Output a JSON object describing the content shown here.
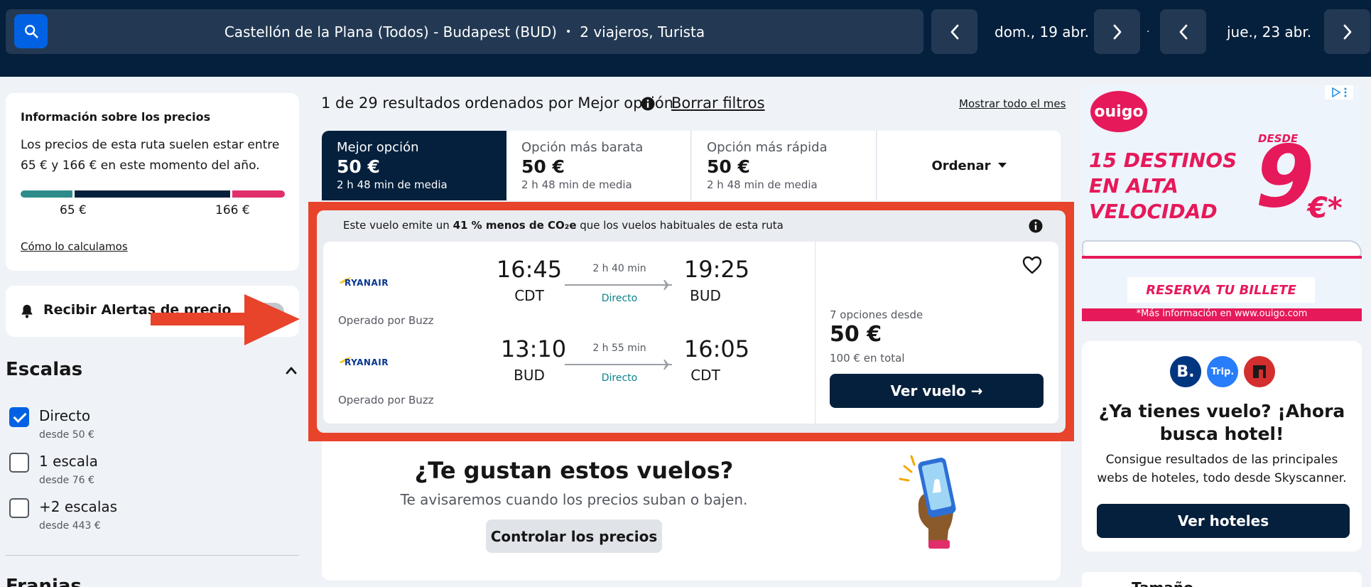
{
  "header": {
    "route": "Castellón de la Plana (Todos) - Budapest (BUD)",
    "separator": "•",
    "travellers": "2 viajeros, Turista",
    "date_out": "dom., 19 abr.",
    "date_sep": "·",
    "date_back": "jue., 23 abr."
  },
  "price_info": {
    "title": "Información sobre los precios",
    "text": "Los precios de esta ruta suelen estar entre 65 € y 166 € en este momento del año.",
    "low": "65 €",
    "high": "166 €",
    "link": "Cómo lo calculamos"
  },
  "alerts": {
    "label": "Recibir Alertas de precio"
  },
  "stops": {
    "title": "Escalas",
    "items": [
      {
        "label": "Directo",
        "sub": "desde 50 €",
        "checked": true
      },
      {
        "label": "1 escala",
        "sub": "desde 76 €",
        "checked": false
      },
      {
        "label": "+2 escalas",
        "sub": "desde 443 €",
        "checked": false
      }
    ],
    "next_title": "Franjas"
  },
  "results": {
    "summary": "1 de 29 resultados ordenados por Mejor opción",
    "clear_filters": "Borrar filtros",
    "show_month": "Mostrar todo el mes"
  },
  "tabs": [
    {
      "label": "Mejor opción",
      "price": "50 €",
      "sub": "2 h 48 min de media"
    },
    {
      "label": "Opción más barata",
      "price": "50 €",
      "sub": "2 h 48 min de media"
    },
    {
      "label": "Opción más rápida",
      "price": "50 €",
      "sub": "2 h 48 min de media"
    }
  ],
  "sort_label": "Ordenar",
  "eco": {
    "pre": "Este vuelo emite un ",
    "bold": "41 % menos de CO₂e",
    "post": " que los vuelos habituales de esta ruta"
  },
  "flight": {
    "legs": [
      {
        "airline": "RYANAIR",
        "dep_time": "16:45",
        "dep_code": "CDT",
        "duration": "2 h 40 min",
        "stops": "Directo",
        "arr_time": "19:25",
        "arr_code": "BUD",
        "operated": "Operado por Buzz"
      },
      {
        "airline": "RYANAIR",
        "dep_time": "13:10",
        "dep_code": "BUD",
        "duration": "2 h 55 min",
        "stops": "Directo",
        "arr_time": "16:05",
        "arr_code": "CDT",
        "operated": "Operado por Buzz"
      }
    ],
    "options": "7 opciones desde",
    "price": "50 €",
    "total": "100 € en total",
    "button": "Ver vuelo →"
  },
  "like": {
    "title": "¿Te gustan estos vuelos?",
    "text": "Te avisaremos cuando los precios suban o bajen.",
    "button": "Controlar los precios"
  },
  "ad": {
    "brand": "ouigo",
    "desde": "DESDE",
    "headline": "15 DESTINOS EN ALTA VELOCIDAD",
    "price": "9",
    "currency": "€*",
    "cta": "RESERVA TU BILLETE",
    "footnote": "*Más información en www.ouigo.com"
  },
  "hotel": {
    "logos": [
      "B.",
      "Trip."
    ],
    "title": "¿Ya tienes vuelo? ¡Ahora busca hotel!",
    "text": "Consigue resultados de las principales webs de hoteles, todo desde Skyscanner.",
    "button": "Ver hoteles",
    "next_text": "Tamaño"
  },
  "colors": {
    "dark": "#05203c",
    "accent": "#0062e3",
    "highlight": "#e8432b",
    "ad_pink": "#e6195a"
  }
}
